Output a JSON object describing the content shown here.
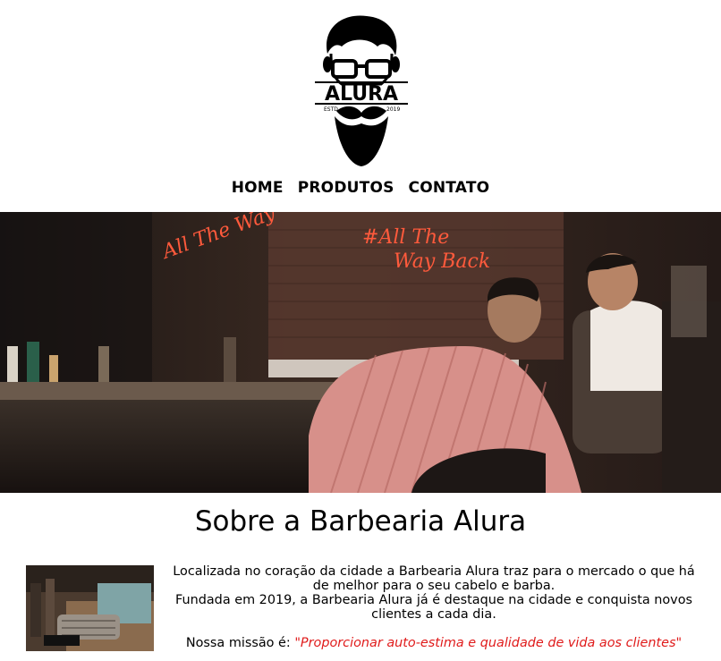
{
  "brand": {
    "logo_text": "ALURA",
    "logo_small_left": "ESTD",
    "logo_small_right": "2019"
  },
  "nav": {
    "items": [
      "HOME",
      "PRODUTOS",
      "CONTATO"
    ]
  },
  "hero": {
    "neon_left": "All The Way",
    "neon_right_1": "#All The",
    "neon_right_2": "Way Back"
  },
  "about": {
    "title": "Sobre a Barbearia Alura",
    "paragraph_1": "Localizada no coração da cidade a Barbearia Alura traz para o mercado o que há de melhor para o seu cabelo e barba.",
    "paragraph_2": "Fundada em 2019, a Barbearia Alura já é destaque na cidade e conquista novos clientes a cada dia.",
    "mission_label": "Nossa missão é: ",
    "mission_quote": "\"Proporcionar auto-estima e qualidade de vida aos clientes\""
  },
  "colors": {
    "accent_red": "#e01b1b",
    "neon": "#ff5a3c"
  }
}
